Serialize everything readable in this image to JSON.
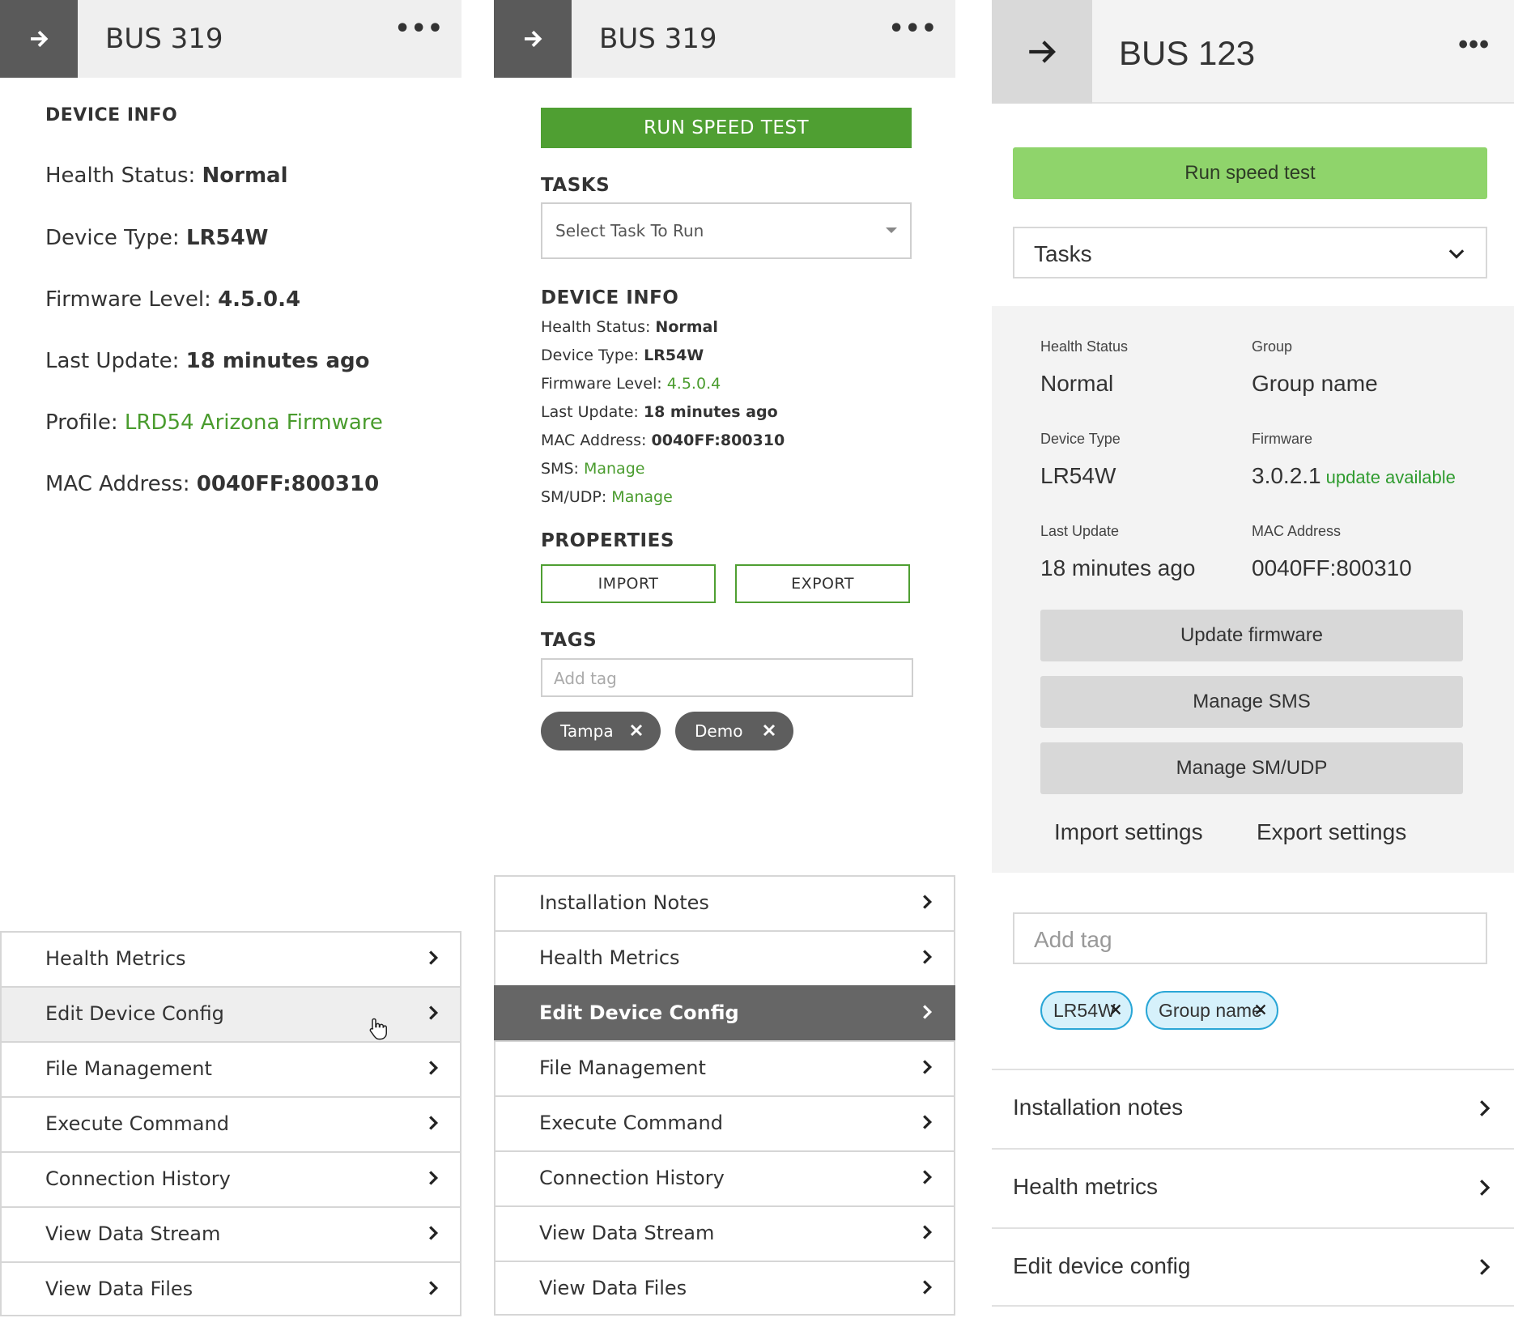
{
  "panel1": {
    "title": "BUS 319",
    "more": "•••",
    "section": "DEVICE INFO",
    "fields": [
      {
        "label": "Health Status: ",
        "value": "Normal"
      },
      {
        "label": "Device Type: ",
        "value": "LR54W"
      },
      {
        "label": "Firmware Level: ",
        "value": "4.5.0.4"
      },
      {
        "label": "Last Update: ",
        "value": "18 minutes ago"
      },
      {
        "label": "Profile: ",
        "value": "LRD54 Arizona Firmware"
      },
      {
        "label": "MAC Address: ",
        "value": "0040FF:800310"
      }
    ],
    "menu": [
      "Health Metrics",
      "Edit Device Config",
      "File Management",
      "Execute Command",
      "Connection History",
      "View Data Stream",
      "View Data Files"
    ]
  },
  "panel2": {
    "title": "BUS 319",
    "more": "•••",
    "run_label": "RUN SPEED TEST",
    "tasks_heading": "TASKS",
    "tasks_placeholder": "Select Task To Run",
    "device_heading": "DEVICE INFO",
    "fields": [
      {
        "label": "Health Status: ",
        "value": "Normal"
      },
      {
        "label": "Device Type: ",
        "value": "LR54W"
      },
      {
        "label": "Firmware Level: ",
        "value": "4.5.0.4"
      },
      {
        "label": "Last Update: ",
        "value": "18 minutes ago"
      },
      {
        "label": "MAC Address: ",
        "value": "0040FF:800310"
      },
      {
        "label": "SMS: ",
        "value": "Manage"
      },
      {
        "label": "SM/UDP: ",
        "value": "Manage"
      }
    ],
    "properties_heading": "PROPERTIES",
    "import_label": "IMPORT",
    "export_label": "EXPORT",
    "tags_heading": "TAGS",
    "tag_placeholder": "Add tag",
    "tags": [
      "Tampa",
      "Demo"
    ],
    "menu": [
      "Installation Notes",
      "Health Metrics",
      "Edit Device Config",
      "File Management",
      "Execute Command",
      "Connection History",
      "View Data Stream",
      "View Data Files"
    ]
  },
  "panel3": {
    "title": "BUS 123",
    "more": "•••",
    "run_label": "Run speed test",
    "tasks_label": "Tasks",
    "health_label": "Health Status",
    "health_value": "Normal",
    "group_label": "Group",
    "group_value": "Group name",
    "type_label": "Device Type",
    "type_value": "LR54W",
    "firmware_label": "Firmware",
    "firmware_value": "3.0.2.1",
    "firmware_update": "update available",
    "update_label": "Last Update",
    "update_value": "18 minutes ago",
    "mac_label": "MAC Address",
    "mac_value": "0040FF:800310",
    "update_fw_label": "Update firmware",
    "sms_label": "Manage SMS",
    "smudp_label": "Manage SM/UDP",
    "import_label": "Import settings",
    "export_label": "Export settings",
    "tag_placeholder": "Add tag",
    "tags": [
      "LR54W",
      "Group name"
    ],
    "list": [
      "Installation notes",
      "Health metrics",
      "Edit device config"
    ]
  },
  "colors": {
    "green": "#4f9f32",
    "light_green": "#8fd46b",
    "dark_gray": "#5a5a5a",
    "chip_blue": "#2aa6d6"
  }
}
